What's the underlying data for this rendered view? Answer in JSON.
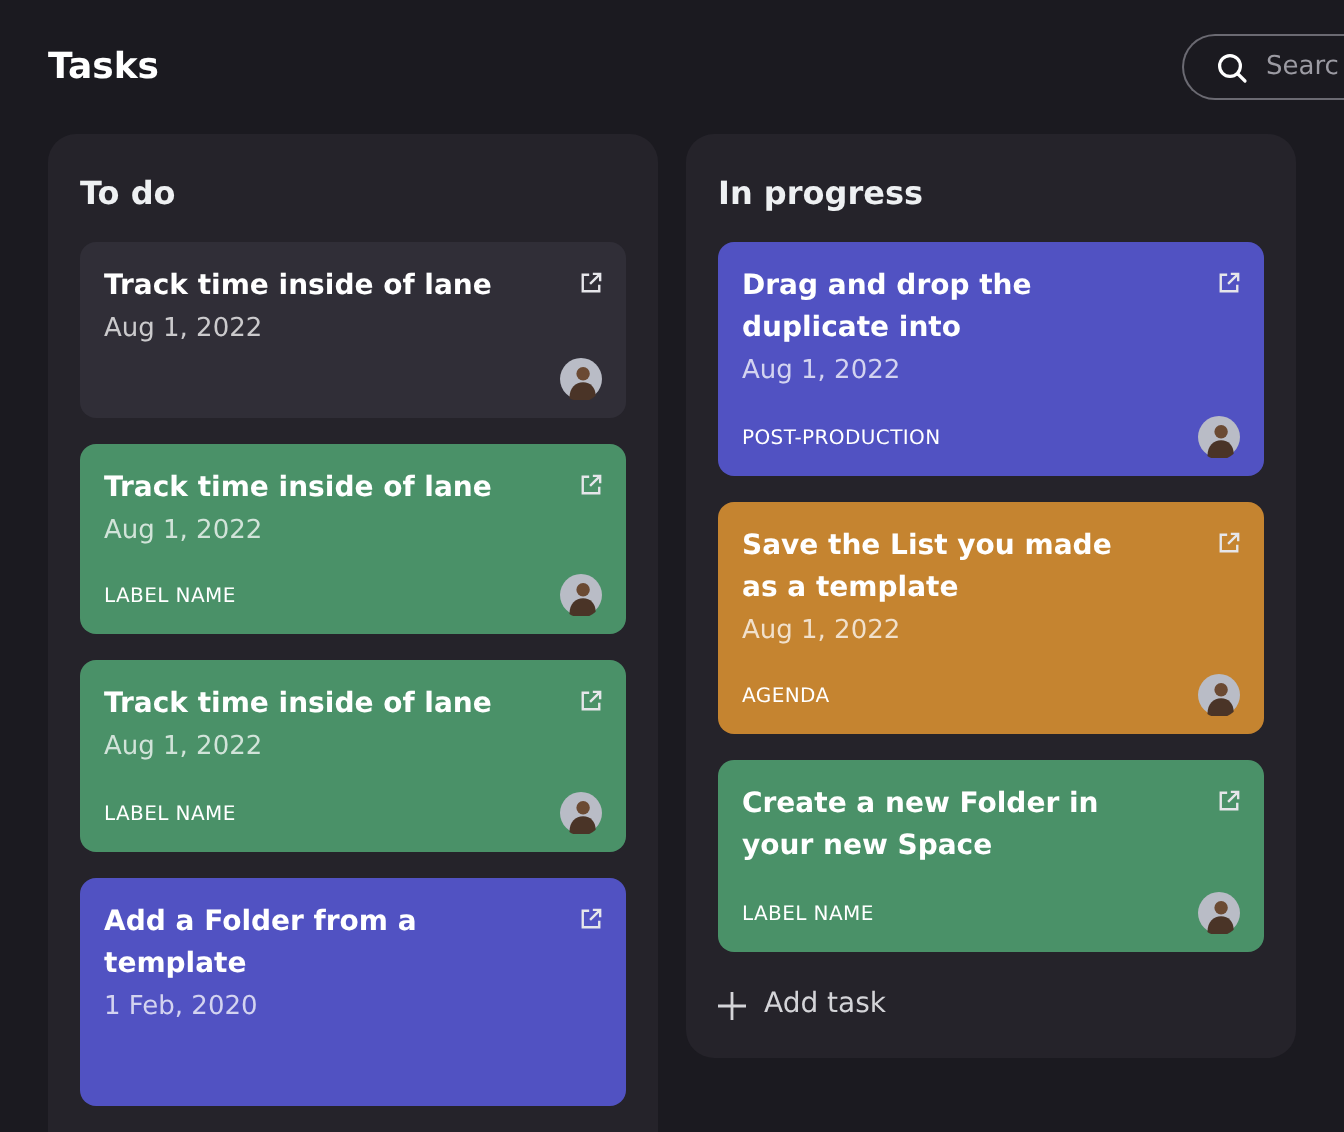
{
  "header": {
    "title": "Tasks",
    "search": {
      "placeholder": "Searc"
    }
  },
  "lanes": [
    {
      "title": "To do",
      "cards": [
        {
          "title": "Track time inside of lane",
          "date": "Aug 1, 2022",
          "color": "#302e37"
        },
        {
          "title": "Track time inside of lane",
          "date": "Aug 1, 2022",
          "label": "LABEL NAME",
          "color": "#4a9168"
        },
        {
          "title": "Track time inside of lane",
          "date": "Aug 1, 2022",
          "label": "LABEL NAME",
          "color": "#4a9168"
        },
        {
          "title": "Add a Folder from a template",
          "date": "1 Feb, 2020",
          "color": "#5152c2"
        }
      ]
    },
    {
      "title": "In progress",
      "cards": [
        {
          "title": "Drag and drop the duplicate into",
          "date": "Aug 1, 2022",
          "label": "POST-PRODUCTION",
          "color": "#5152c2"
        },
        {
          "title": "Save the List you made as a template",
          "date": "Aug 1, 2022",
          "label": "AGENDA",
          "color": "#c58430"
        },
        {
          "title": "Create a new Folder in your new Space",
          "label": "LABEL NAME",
          "color": "#4a9168"
        }
      ],
      "add_button": "Add task"
    }
  ]
}
